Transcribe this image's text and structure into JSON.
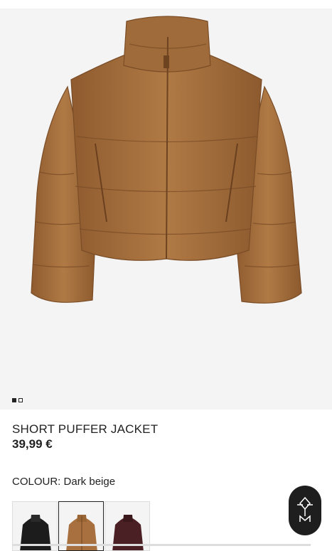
{
  "product": {
    "title": "SHORT PUFFER JACKET",
    "price": "39,99 €",
    "colour_label": "COLOUR:",
    "colour_value": "Dark beige",
    "colour_hex": "#a8703f"
  },
  "gallery": {
    "image_count": 2,
    "active_index": 0,
    "image_icon": "brown-puffer-jacket-photo"
  },
  "swatches": [
    {
      "name": "Black",
      "hex": "#1c1c1c",
      "selected": false
    },
    {
      "name": "Dark beige",
      "hex": "#a8703f",
      "selected": true
    },
    {
      "name": "Burgundy",
      "hex": "#4a2024",
      "selected": false
    }
  ],
  "fab": {
    "icon": "assistant-logo-icon"
  }
}
